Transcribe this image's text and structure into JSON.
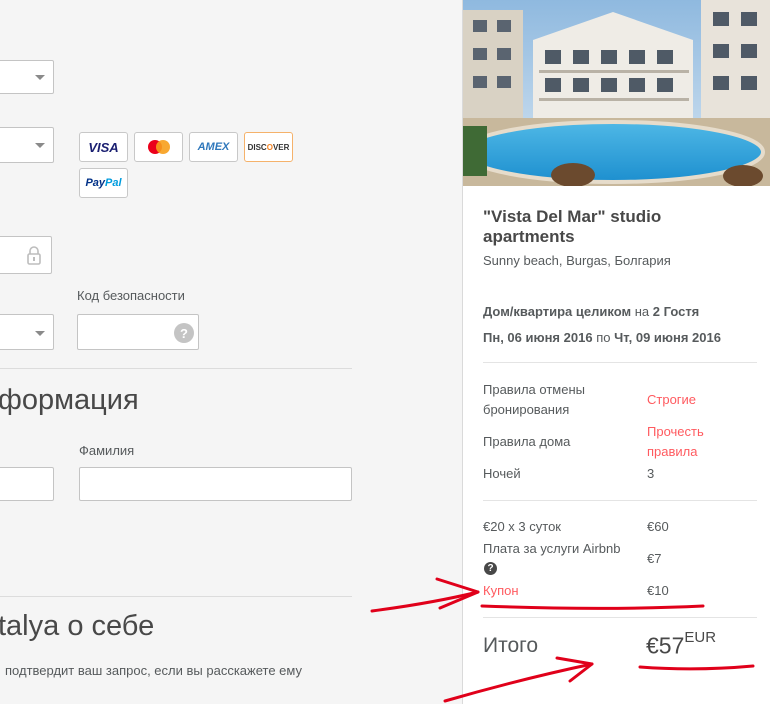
{
  "form": {
    "security_code_label": "Код безопасности",
    "security_help_icon": "?",
    "section_info_title": "формация",
    "last_name_label": "Фамилия",
    "about_title": "talya о себе",
    "about_hint": "подтвердит ваш запрос, если вы расскажете ему",
    "cards": [
      "VISA",
      "mastercard",
      "AMEX",
      "DISCOVER",
      "PayPal"
    ]
  },
  "listing": {
    "title": "\"Vista Del Mar\" studio apartments",
    "location": "Sunny beach, Burgas, Болгария",
    "home_type": "Дом/квартира целиком",
    "for_word": "на",
    "guests": "2 Гостя",
    "date_from": "Пн, 06 июня 2016",
    "date_sep": "по",
    "date_to": "Чт, 09 июня 2016"
  },
  "policies": {
    "cancel_label": "Правила отмены бронирования",
    "cancel_value": "Строгие",
    "house_label": "Правила дома",
    "house_value": "Прочесть правила",
    "nights_label": "Ночей",
    "nights_value": "3"
  },
  "pricing": {
    "nights_line_label": "€20 x 3 суток",
    "nights_line_value": "€60",
    "service_fee_label": "Плата за услуги Airbnb",
    "service_fee_value": "€7",
    "coupon_label": "Купон",
    "coupon_value": "€10",
    "total_label": "Итого",
    "total_value": "€57",
    "currency": "EUR"
  },
  "colors": {
    "accent": "#ff5a5f",
    "annotation": "#e0001a",
    "visa": "#1a1f71",
    "amex": "#2e77bb",
    "discover": "#f58220",
    "paypal": "#003087"
  }
}
